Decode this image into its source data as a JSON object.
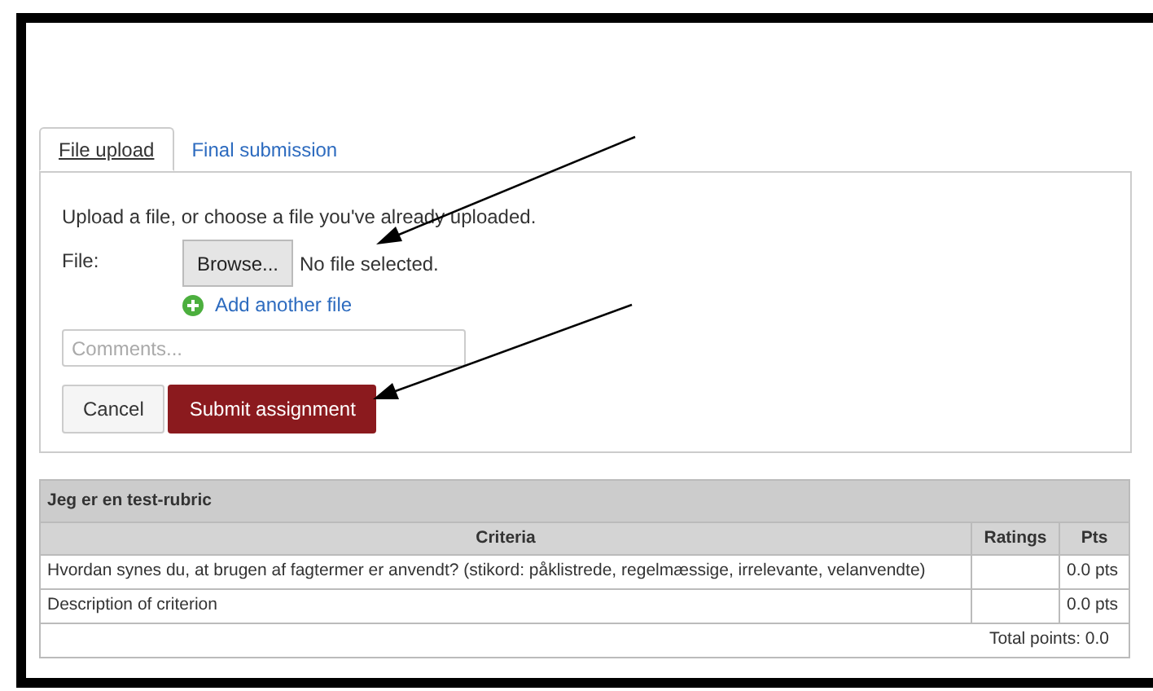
{
  "tabs": [
    {
      "label": "File upload",
      "selected": true
    },
    {
      "label": "Final submission",
      "selected": false
    }
  ],
  "upload": {
    "instruction": "Upload a file, or choose a file you've already uploaded.",
    "file_label": "File:",
    "browse_button": "Browse...",
    "file_status": "No file selected.",
    "add_link": "Add another file",
    "comments": {
      "placeholder": "Comments..."
    },
    "buttons": [
      {
        "label": "Cancel",
        "kind": "secondary"
      },
      {
        "label": "Submit assignment",
        "kind": "primary"
      }
    ]
  },
  "rubric": {
    "title": "Jeg er en test-rubric",
    "columns": [
      "Criteria",
      "Ratings",
      "Pts"
    ],
    "rows": [
      {
        "criteria": "Hvordan synes du, at brugen af fagtermer er anvendt? (stikord: påklistrede, regelmæssige, irrelevante, velanvendte)",
        "pts": "0.0 pts"
      },
      {
        "criteria": "Description of criterion",
        "pts": "0.0 pts"
      }
    ],
    "total": "Total points: 0.0"
  }
}
